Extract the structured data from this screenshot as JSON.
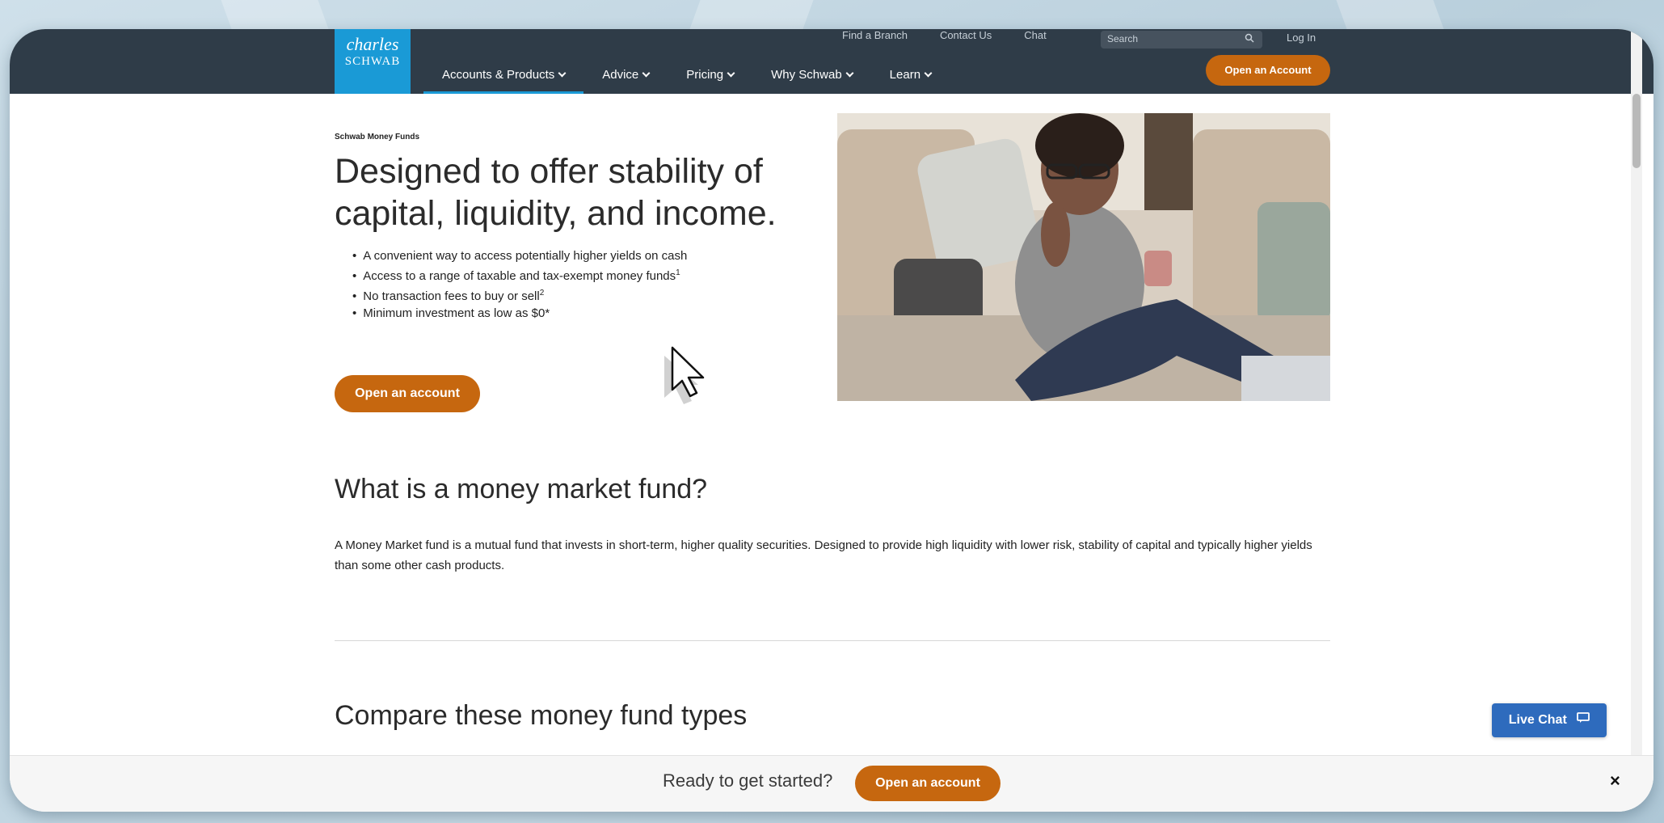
{
  "nav": {
    "logo_line1": "charles",
    "logo_line2": "SCHWAB",
    "util_links": [
      "Find a Branch",
      "Contact Us",
      "Chat"
    ],
    "search_placeholder": "Search",
    "login_label": "Log In",
    "menu": [
      {
        "label": "Accounts & Products"
      },
      {
        "label": "Advice"
      },
      {
        "label": "Pricing"
      },
      {
        "label": "Why Schwab"
      },
      {
        "label": "Learn"
      }
    ],
    "cta_label": "Open an Account"
  },
  "hero": {
    "eyebrow": "Schwab Money Funds",
    "title": "Designed to offer stability of capital, liquidity, and income.",
    "bullets": [
      {
        "text": "A convenient way to access potentially higher yields on cash",
        "sup": ""
      },
      {
        "text": "Access to a range of taxable and tax-exempt money funds",
        "sup": "1"
      },
      {
        "text": "No transaction fees to buy or sell",
        "sup": "2"
      },
      {
        "text": "Minimum investment as low as $0*",
        "sup": ""
      }
    ],
    "cta_label": "Open an account"
  },
  "section1": {
    "heading": "What is a money market fund?",
    "body": "A Money Market fund is a mutual fund that invests in short-term, higher quality securities. Designed to provide high liquidity with lower risk, stability of capital and typically higher yields than some other cash products."
  },
  "section2": {
    "heading": "Compare these money fund types"
  },
  "sticky": {
    "prompt": "Ready to get started?",
    "cta_label": "Open an account",
    "close": "×"
  },
  "live_chat": {
    "label": "Live Chat"
  },
  "colors": {
    "nav_bg": "#2f3c48",
    "brand_blue": "#1a9ad6",
    "cta_orange": "#c6670f",
    "chat_blue": "#2e6bbd"
  }
}
